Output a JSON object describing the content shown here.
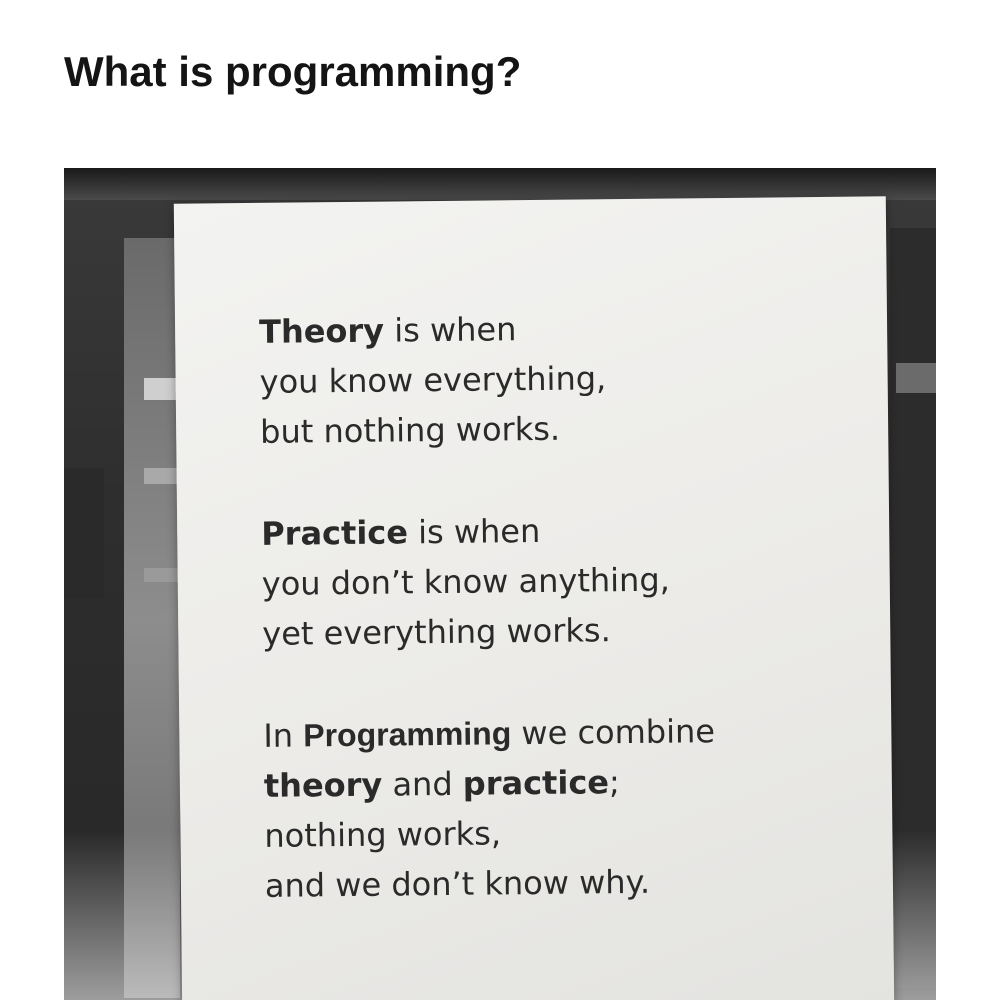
{
  "headline": "What is programming?",
  "photo": {
    "sign": {
      "stanzas": [
        {
          "lines": [
            {
              "bold": "Theory",
              "rest": " is when"
            },
            {
              "text": "you know everything,"
            },
            {
              "text": "but nothing works."
            }
          ]
        },
        {
          "lines": [
            {
              "bold": "Practice",
              "rest": " is when"
            },
            {
              "text": "you don’t know anything,"
            },
            {
              "text": "yet everything works."
            }
          ]
        },
        {
          "lines": [
            {
              "pre": "In ",
              "bold": "Programming",
              "rest": " we combine"
            },
            {
              "bold": "theory",
              "mid": " and ",
              "bold2": "practice",
              "rest": ";"
            },
            {
              "text": "nothing works,"
            },
            {
              "text": "and we don’t know why."
            }
          ]
        }
      ]
    }
  }
}
